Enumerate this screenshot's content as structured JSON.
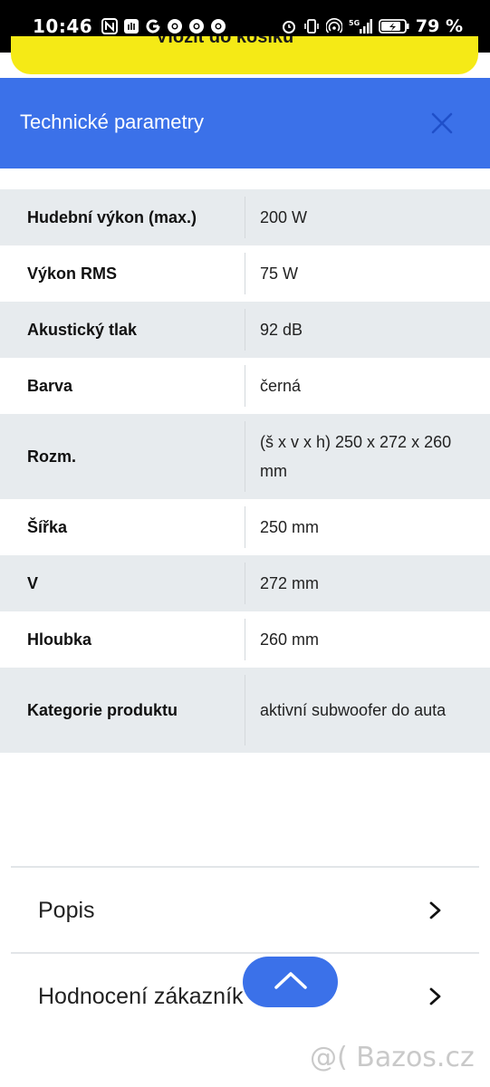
{
  "status_bar": {
    "time": "10:46",
    "network": "5G",
    "battery_percent": "79 %",
    "icons": [
      "nfc-icon",
      "hand-icon",
      "google-icon",
      "chrome-icon",
      "chrome-icon",
      "chrome-icon",
      "alarm-icon",
      "vibrate-icon",
      "hotspot-icon",
      "signal-icon",
      "battery-charging-icon"
    ]
  },
  "cart_button": {
    "label": "Vložit do košíku"
  },
  "panel": {
    "title": "Technické parametry"
  },
  "specs": [
    {
      "key": "Hudební výkon (max.)",
      "value": "200 W"
    },
    {
      "key": "Výkon RMS",
      "value": "75 W"
    },
    {
      "key": "Akustický tlak",
      "value": "92 dB"
    },
    {
      "key": "Barva",
      "value": "černá"
    },
    {
      "key": "Rozm.",
      "value": "(š x v x h) 250 x 272 x 260 mm"
    },
    {
      "key": "Šířka",
      "value": "250 mm"
    },
    {
      "key": "V",
      "value": "272 mm"
    },
    {
      "key": "Hloubka",
      "value": "260 mm"
    },
    {
      "key": "Kategorie produktu",
      "value": "aktivní subwoofer do auta"
    }
  ],
  "accordion": [
    {
      "label": "Popis"
    },
    {
      "label": "Hodnocení zákazník"
    }
  ],
  "watermark": "@( Bazos.cz",
  "colors": {
    "accent": "#3b71e9",
    "cart": "#f5ea16",
    "row_alt": "#e7ebee"
  }
}
